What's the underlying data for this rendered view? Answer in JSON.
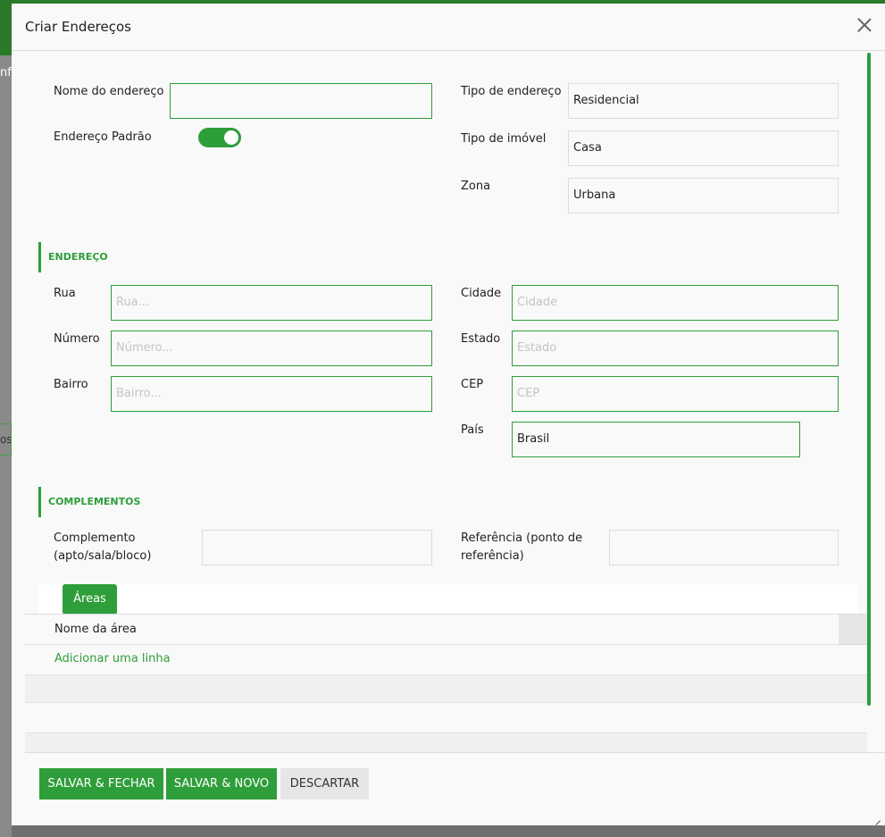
{
  "background": {
    "left_label": "nfi",
    "left_tab": "os"
  },
  "modal": {
    "title": "Criar Endereços"
  },
  "form": {
    "nome_label": "Nome do endereço",
    "nome_value": "",
    "padrao_label": "Endereço Padrão",
    "padrao_on": true,
    "tipo_endereco_label": "Tipo de endereço",
    "tipo_endereco_value": "Residencial",
    "tipo_imovel_label": "Tipo de imóvel",
    "tipo_imovel_value": "Casa",
    "zona_label": "Zona",
    "zona_value": "Urbana"
  },
  "endereco": {
    "section_title": "ENDEREÇO",
    "rua_label": "Rua",
    "rua_placeholder": "Rua...",
    "numero_label": "Número",
    "numero_placeholder": "Número...",
    "bairro_label": "Bairro",
    "bairro_placeholder": "Bairro...",
    "cidade_label": "Cidade",
    "cidade_placeholder": "Cidade",
    "estado_label": "Estado",
    "estado_placeholder": "Estado",
    "cep_label": "CEP",
    "cep_placeholder": "CEP",
    "pais_label": "País",
    "pais_value": "Brasil"
  },
  "complementos": {
    "section_title": "COMPLEMENTOS",
    "complemento_label_line1": "Complemento",
    "complemento_label_line2": "(apto/sala/bloco)",
    "referencia_label_line1": "Referência (ponto de",
    "referencia_label_line2": "referência)"
  },
  "areas": {
    "tab_label": "Áreas",
    "column_header": "Nome da área",
    "add_line": "Adicionar uma linha"
  },
  "buttons": {
    "save_close": "SALVAR & FECHAR",
    "save_new": "SALVAR & NOVO",
    "discard": "DESCARTAR"
  },
  "colors": {
    "accent": "#2e9e3a",
    "header_bar": "#2a7a2a"
  }
}
